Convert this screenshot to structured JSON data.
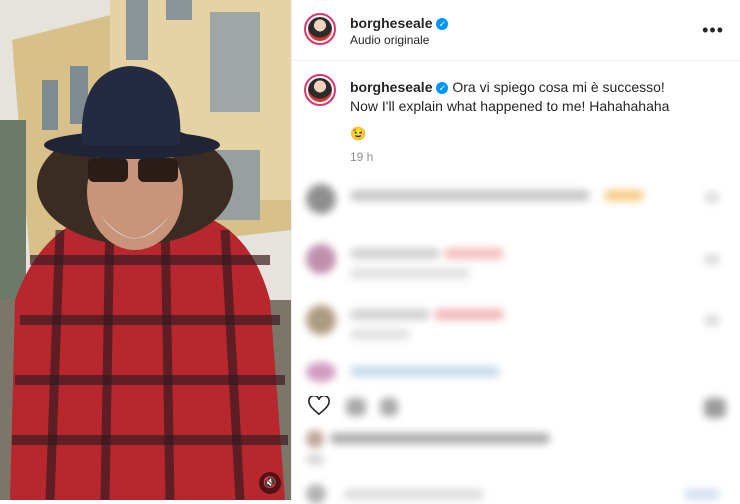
{
  "post": {
    "username": "borgheseale",
    "audio": "Audio originale",
    "caption_it": "Ora vi spiego cosa mi è successo!",
    "caption_en": "Now I'll explain what happened to me! Hahahahaha",
    "emoji": "😉",
    "time": "19 h",
    "more_label": "•••",
    "verified_mark": "✓",
    "mute_icon": "🔇"
  },
  "colors": {
    "story_ring": "#e1306c",
    "verified": "#0095f6"
  }
}
